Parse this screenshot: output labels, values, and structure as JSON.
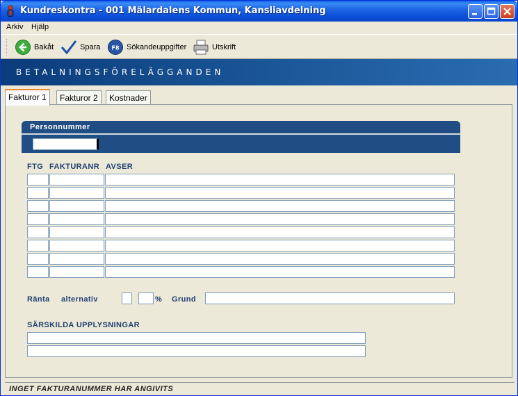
{
  "window": {
    "title": "Kundreskontra  -  001 Mälardalens Kommun, Kansliavdelning"
  },
  "menu": {
    "items": [
      {
        "label": "Arkiv"
      },
      {
        "label": "Hjälp"
      }
    ]
  },
  "toolbar": {
    "back_label": "Bakåt",
    "save_label": "Spara",
    "search_label": "Sökandeuppgifter",
    "search_key": "F8",
    "print_label": "Utskrift"
  },
  "banner": {
    "title": "BETALNINGSFÖRELÄGGANDEN"
  },
  "tabs": [
    {
      "label": "Fakturor 1",
      "active": true
    },
    {
      "label": "Fakturor 2",
      "active": false
    },
    {
      "label": "Kostnader",
      "active": false
    }
  ],
  "form": {
    "personnummer_label": "Personnummer",
    "personnummer_value": "",
    "invoice_headers": {
      "ftg": "FTG",
      "fakturanr": "FAKTURANR",
      "avser": "AVSER"
    },
    "invoice_rows": 8,
    "ranta_label": "Ränta",
    "alternativ_label": "alternativ",
    "percent_label": "%",
    "grund_label": "Grund",
    "sarskilda_label": "SÄRSKILDA UPPLYSNINGAR"
  },
  "status": {
    "message": "INGET FAKTURANUMMER HAR ANGIVITS"
  },
  "colors": {
    "banner": "#1a5596",
    "header_block": "#1f4d84",
    "label_text": "#1f3f73",
    "active_tab_accent": "#e68b2c"
  }
}
